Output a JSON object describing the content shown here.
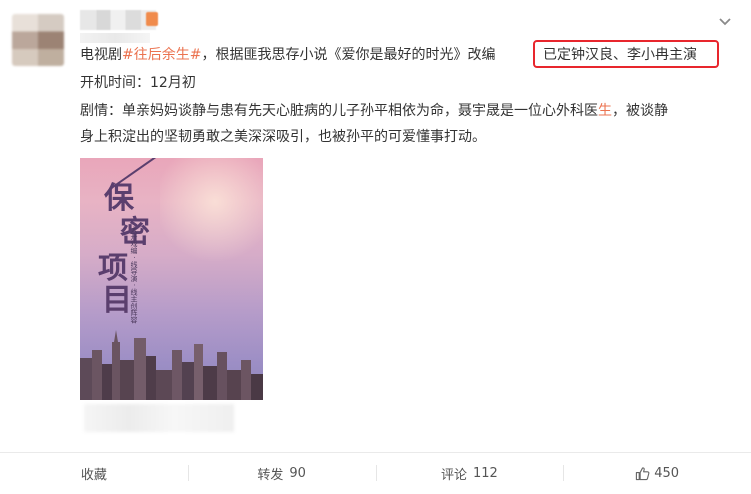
{
  "post": {
    "text": {
      "line1_prefix": "电视剧",
      "hashtag": "#往后余生#",
      "line1_suffix": "，根据匪我思存小说《爱你是最好的时光》改编",
      "highlight_box_text": "已定钟汉良、李小冉主演",
      "line2": "开机时间：12月初",
      "line3_before": "剧情：单亲妈妈谈静与患有先天心脏病的儿子孙平相依为命，聂宇晟是一位心外科医",
      "line3_highlight": "生",
      "line3_after": "，被谈静",
      "line4": "身上积淀出的坚韧勇敢之美深深吸引，也被孙平的可爱懂事打动。"
    },
    "poster": {
      "title_char1": "保",
      "title_char2": "密",
      "title_char3": "项",
      "title_char4": "目",
      "subtitle": "大开戏编 · 线导演 · 线主创阵容"
    }
  },
  "actions": {
    "favorite_label": "收藏",
    "repost_label": "转发",
    "repost_count": "90",
    "comment_label": "评论",
    "comment_count": "112",
    "like_count": "450"
  },
  "icons": {
    "menu": "chevron-down-icon",
    "like": "thumbs-up-icon"
  },
  "colors": {
    "hashtag": "#eb7350",
    "highlight_box": "#e8262d"
  }
}
